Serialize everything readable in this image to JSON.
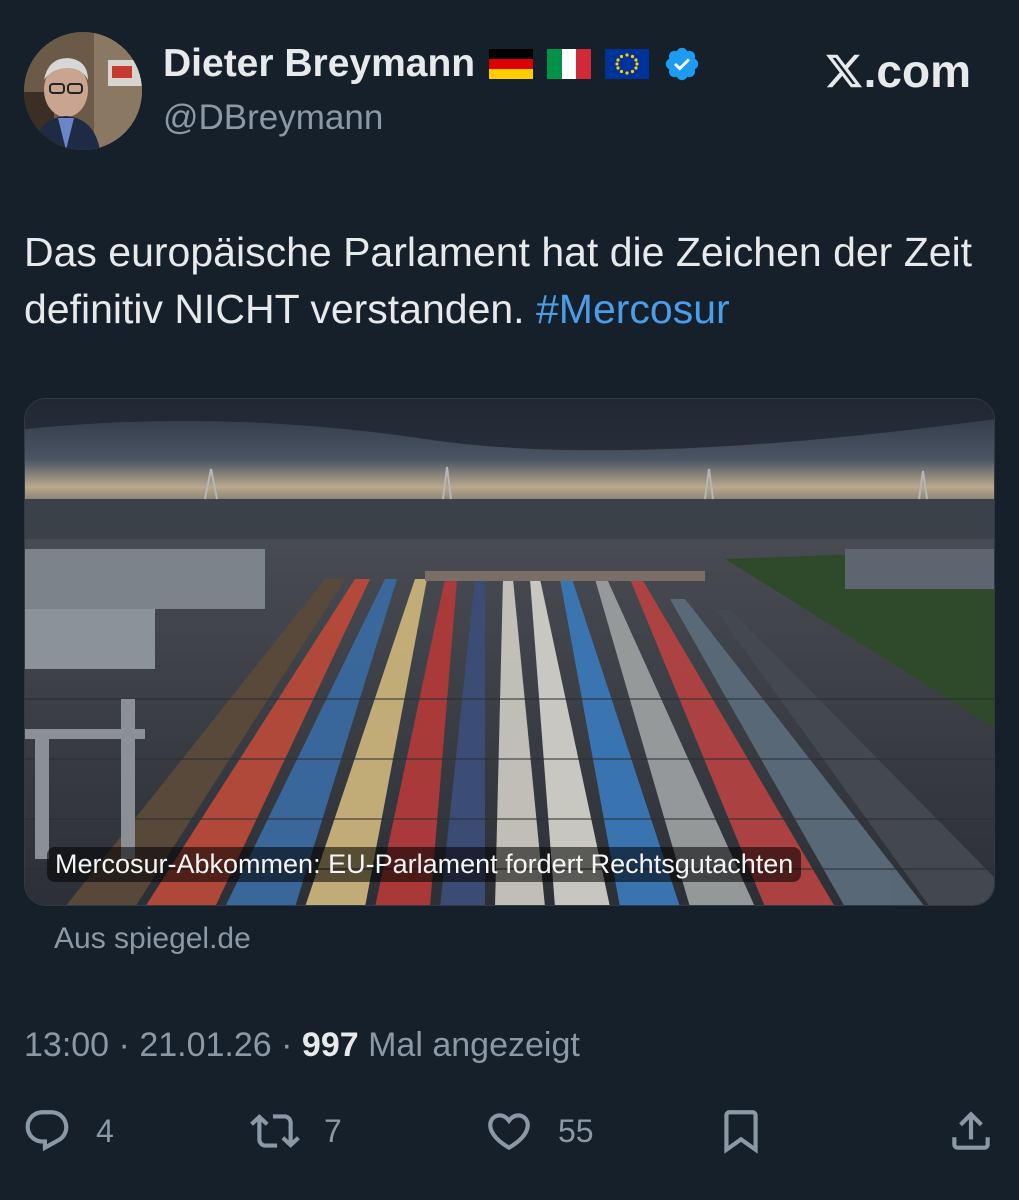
{
  "author": {
    "name": "Dieter Breymann",
    "handle": "@DBreymann",
    "flags": [
      "germany-flag",
      "italy-flag",
      "eu-flag"
    ],
    "verified": true
  },
  "site": {
    "logo_text": ".com"
  },
  "tweet": {
    "text": "Das europäische Parlament hat die Zeichen der Zeit definitiv NICHT verstanden.",
    "hashtag": "#Mercosur"
  },
  "card": {
    "caption": "Mercosur-Abkommen: EU-Parlament fordert Rechtsgutachten",
    "source": "Aus spiegel.de"
  },
  "meta": {
    "time": "13:00",
    "date": "21.01.26",
    "views": "997",
    "views_label": "Mal angezeigt",
    "separator": "·"
  },
  "actions": {
    "replies": "4",
    "reposts": "7",
    "likes": "55"
  },
  "colors": {
    "background": "#16202b",
    "text": "#e7e9ea",
    "secondary": "#8b98a5",
    "link": "#4a9de8",
    "verified": "#1d9bf0"
  }
}
